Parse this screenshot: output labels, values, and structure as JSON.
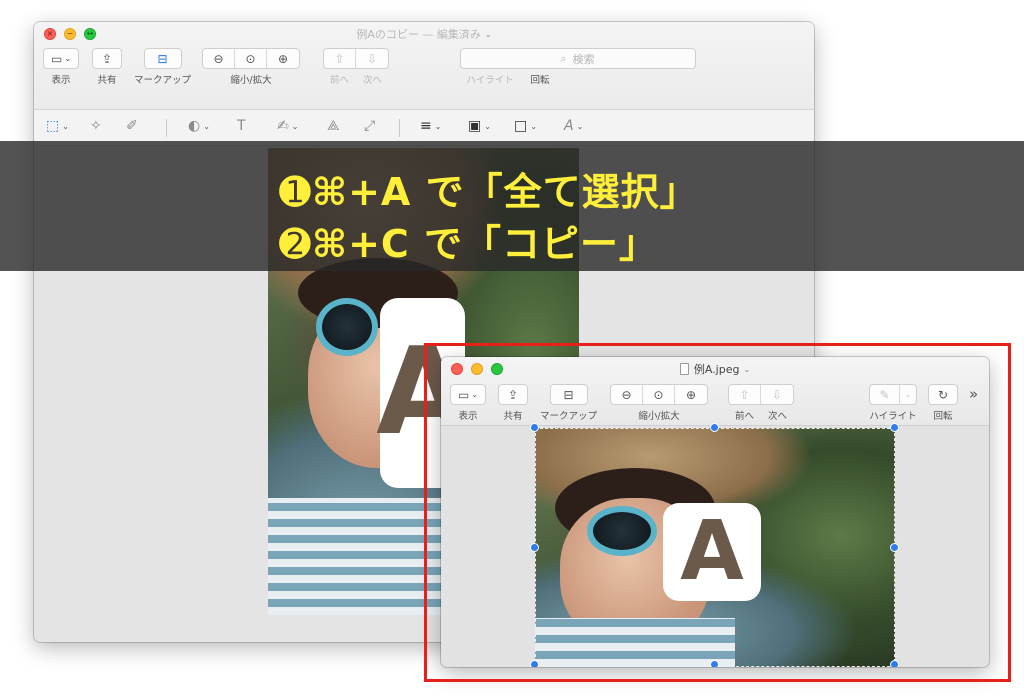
{
  "back_window": {
    "title": "例Aのコピー — 編集済み",
    "title_chevron": "⌄",
    "toolbar": {
      "view_label": "表示",
      "share_label": "共有",
      "markup_label": "マークアップ",
      "zoom_label": "縮小/拡大",
      "prev_label": "前へ",
      "next_label": "次へ",
      "highlight_label": "ハイライト",
      "rotate_label": "回転",
      "search_placeholder": "検索",
      "search_label": "検索"
    },
    "icons": {
      "sidebar": "▭",
      "share": "⇪",
      "markup": "⊟",
      "zoom_out": "⊖",
      "zoom_fit": "⊙",
      "zoom_in": "⊕",
      "prev": "⇧",
      "next": "⇩",
      "highlight": "✎",
      "rotate": "↻",
      "search": "⌕",
      "select": "⬚",
      "wand": "✧",
      "sketch": "✐",
      "shapes": "◐",
      "text": "T",
      "sign": "✍",
      "adjust": "⟁",
      "resize": "⤢",
      "lines": "≡",
      "border": "▣",
      "fill": "□",
      "font": "A",
      "chevron": "⌄"
    }
  },
  "banner": {
    "line1": "➊⌘+A  で「全て選択」",
    "line2": "➋⌘+C  で「コピー」",
    "text_color": "#ffef3a"
  },
  "front_window": {
    "title": "例A.jpeg",
    "title_chevron": "⌄",
    "toolbar": {
      "view_label": "表示",
      "share_label": "共有",
      "markup_label": "マークアップ",
      "zoom_label": "縮小/拡大",
      "prev_label": "前へ",
      "next_label": "次へ",
      "highlight_label": "ハイライト",
      "rotate_label": "回転",
      "overflow": "»"
    }
  },
  "image": {
    "badge_letter": "A"
  },
  "colors": {
    "highlight_frame": "#e8201a",
    "selection_handle": "#2f7cf0",
    "banner_text": "#ffef3a"
  }
}
